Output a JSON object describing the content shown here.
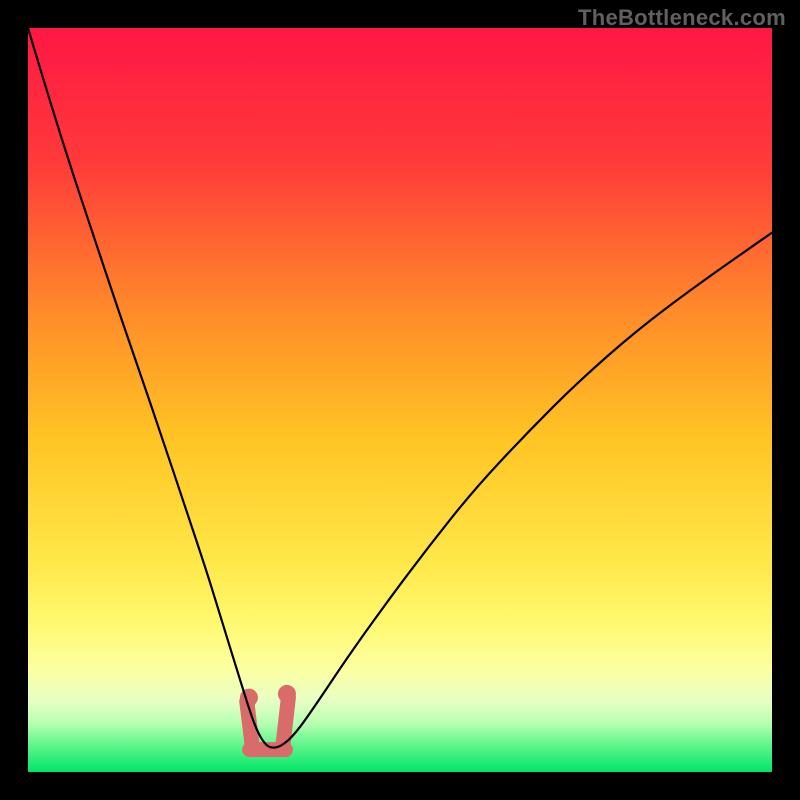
{
  "watermark": "TheBottleneck.com",
  "chart_data": {
    "type": "line",
    "title": "",
    "xlabel": "",
    "ylabel": "",
    "xlim": [
      0,
      100
    ],
    "ylim": [
      0,
      100
    ],
    "grid": false,
    "legend": false,
    "background_gradient": {
      "direction": "vertical",
      "stops": [
        {
          "pos": 0.0,
          "color": "#ff1744"
        },
        {
          "pos": 0.18,
          "color": "#ff3a3a"
        },
        {
          "pos": 0.38,
          "color": "#ff8a2a"
        },
        {
          "pos": 0.55,
          "color": "#ffc423"
        },
        {
          "pos": 0.72,
          "color": "#ffe84a"
        },
        {
          "pos": 0.8,
          "color": "#fff970"
        },
        {
          "pos": 0.86,
          "color": "#fdffa0"
        },
        {
          "pos": 0.905,
          "color": "#e7ffc4"
        },
        {
          "pos": 0.935,
          "color": "#b6ffb0"
        },
        {
          "pos": 0.965,
          "color": "#5cf58a"
        },
        {
          "pos": 1.0,
          "color": "#00e56a"
        }
      ]
    },
    "series": [
      {
        "name": "bottleneck_curve",
        "stroke": "#000000",
        "stroke_width": 2.2,
        "x": [
          0,
          3,
          6,
          9,
          12,
          15,
          18,
          21,
          24,
          26,
          28,
          29.5,
          30.5,
          31.5,
          32.5,
          34,
          36,
          39,
          43,
          48,
          54,
          60,
          67,
          74,
          82,
          90,
          100
        ],
        "y": [
          100,
          90,
          80.5,
          71.5,
          62.5,
          53.8,
          45,
          36,
          27,
          20.5,
          14,
          9.2,
          6.2,
          4.2,
          3.2,
          3.4,
          5.2,
          9.5,
          15.5,
          22.5,
          30.5,
          38,
          45.5,
          52.5,
          59.5,
          65.5,
          72.5
        ]
      }
    ],
    "flat_zone": {
      "x0": 29.0,
      "x1": 34.2,
      "y": 3.0
    },
    "markers": [
      {
        "name": "marker-left",
        "x": 29.7,
        "y": 10.0,
        "color": "#d96b6b",
        "radius": 9
      },
      {
        "name": "marker-right",
        "x": 34.8,
        "y": 10.5,
        "color": "#d96b6b",
        "radius": 9
      }
    ],
    "flat_segments": [
      {
        "name": "flat-seg-left",
        "x0": 29.4,
        "x1": 30.2,
        "y0": 9.5,
        "y1": 3.0,
        "color": "#d96b6b",
        "width": 15
      },
      {
        "name": "flat-seg-bottom",
        "x0": 29.8,
        "x1": 34.6,
        "y0": 3.0,
        "y1": 3.0,
        "color": "#d96b6b",
        "width": 15
      },
      {
        "name": "flat-seg-right",
        "x0": 34.2,
        "x1": 35.0,
        "y0": 3.0,
        "y1": 10.0,
        "color": "#d96b6b",
        "width": 15
      }
    ]
  }
}
